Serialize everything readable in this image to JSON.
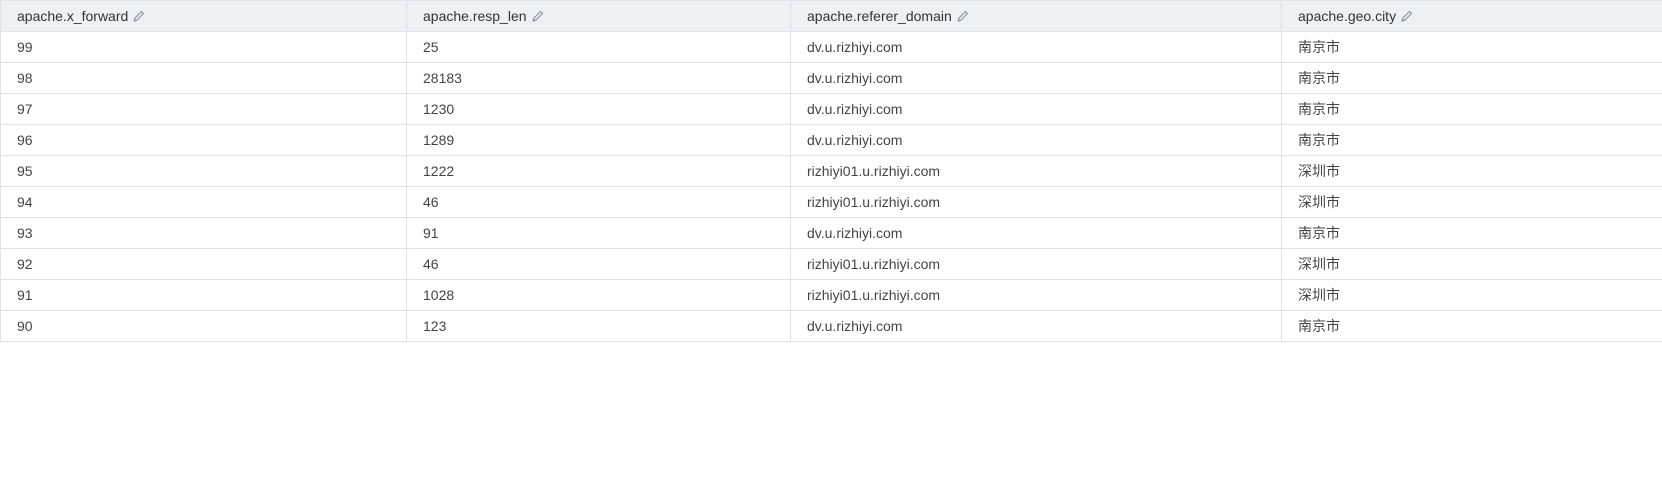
{
  "table": {
    "columns": [
      {
        "label": "apache.x_forward",
        "icon": "edit-icon"
      },
      {
        "label": "apache.resp_len",
        "icon": "edit-icon"
      },
      {
        "label": "apache.referer_domain",
        "icon": "edit-icon"
      },
      {
        "label": "apache.geo.city",
        "icon": "edit-icon"
      }
    ],
    "rows": [
      [
        "99",
        "25",
        "dv.u.rizhiyi.com",
        "南京市"
      ],
      [
        "98",
        "28183",
        "dv.u.rizhiyi.com",
        "南京市"
      ],
      [
        "97",
        "1230",
        "dv.u.rizhiyi.com",
        "南京市"
      ],
      [
        "96",
        "1289",
        "dv.u.rizhiyi.com",
        "南京市"
      ],
      [
        "95",
        "1222",
        "rizhiyi01.u.rizhiyi.com",
        "深圳市"
      ],
      [
        "94",
        "46",
        "rizhiyi01.u.rizhiyi.com",
        "深圳市"
      ],
      [
        "93",
        "91",
        "dv.u.rizhiyi.com",
        "南京市"
      ],
      [
        "92",
        "46",
        "rizhiyi01.u.rizhiyi.com",
        "深圳市"
      ],
      [
        "91",
        "1028",
        "rizhiyi01.u.rizhiyi.com",
        "深圳市"
      ],
      [
        "90",
        "123",
        "dv.u.rizhiyi.com",
        "南京市"
      ]
    ]
  },
  "colors": {
    "header_bg": "#eef1f4",
    "border": "#dfe3e8",
    "text": "#333333",
    "icon": "#8a94a6"
  }
}
